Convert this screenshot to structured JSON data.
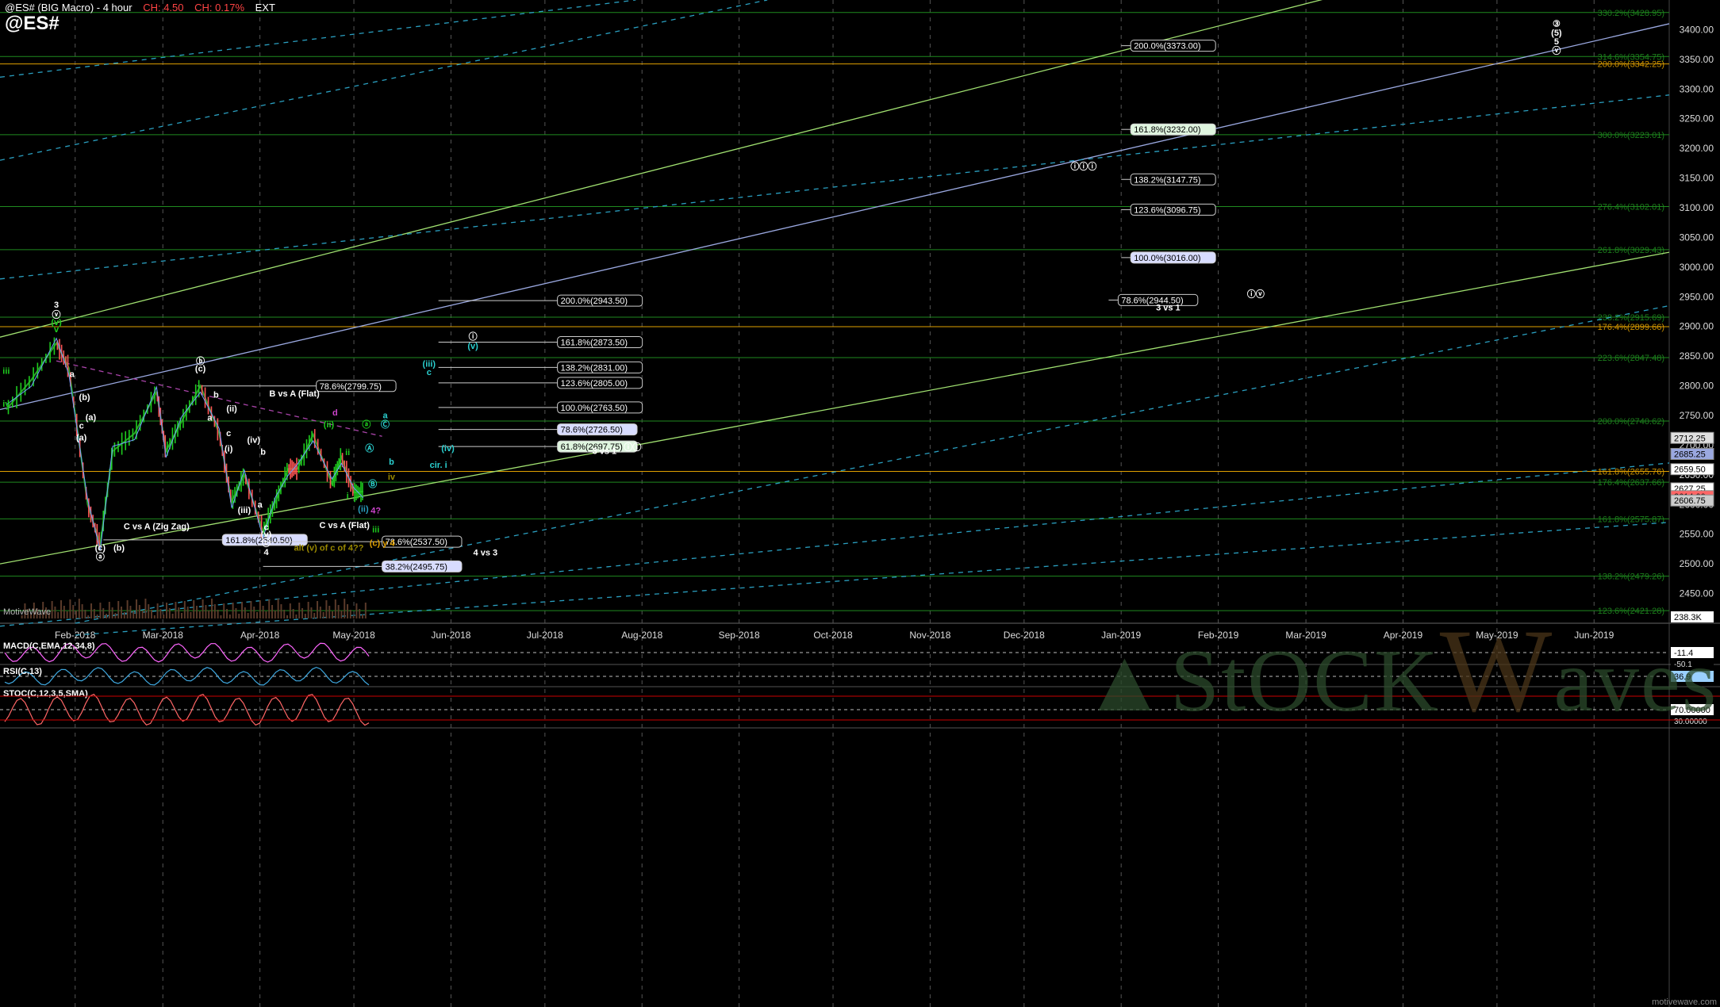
{
  "header": {
    "title": "@ES# (BIG Macro) - 4 hour",
    "change_abs": "CH: 4.50",
    "change_pct": "CH: 0.17%",
    "session": "EXT",
    "symbol": "@ES#"
  },
  "watermark": {
    "part1": "▲StOCK",
    "part2": "W",
    "part3": "aves"
  },
  "footer": "motivewave.com",
  "colors": {
    "bg": "#000000",
    "grid": "#555555",
    "fib_green": "#1f8a1f",
    "fib_orange": "#e0a000",
    "trend_green": "#a0e070",
    "trend_blue": "#9aa8e0",
    "channel_cyan": "#2a9fc0",
    "price_green": "#1ecc1e",
    "price_red": "#ff5555"
  },
  "chart_data": {
    "type": "line",
    "title": "@ES# (BIG Macro) - 4 hour",
    "x_ticks": [
      "Feb-2018",
      "Mar-2018",
      "Apr-2018",
      "May-2018",
      "Jun-2018",
      "Jul-2018",
      "Aug-2018",
      "Sep-2018",
      "Oct-2018",
      "Nov-2018",
      "Dec-2018",
      "Jan-2019",
      "Feb-2019",
      "Mar-2019",
      "Apr-2019",
      "May-2019",
      "Jun-2019"
    ],
    "y_ticks": [
      3400,
      3350,
      3300,
      3250,
      3200,
      3150,
      3100,
      3050,
      3000,
      2950,
      2900,
      2850,
      2800,
      2750,
      2700,
      2650,
      2600,
      2550,
      2500,
      2450
    ],
    "ylim": [
      2400,
      3450
    ],
    "price_path": [
      {
        "x": "2018-01-10",
        "y": 2760
      },
      {
        "x": "2018-01-18",
        "y": 2810
      },
      {
        "x": "2018-01-26",
        "y": 2872
      },
      {
        "x": "2018-01-30",
        "y": 2830
      },
      {
        "x": "2018-02-05",
        "y": 2600
      },
      {
        "x": "2018-02-09",
        "y": 2533
      },
      {
        "x": "2018-02-13",
        "y": 2690
      },
      {
        "x": "2018-02-20",
        "y": 2720
      },
      {
        "x": "2018-02-27",
        "y": 2790
      },
      {
        "x": "2018-03-02",
        "y": 2690
      },
      {
        "x": "2018-03-07",
        "y": 2740
      },
      {
        "x": "2018-03-13",
        "y": 2800
      },
      {
        "x": "2018-03-19",
        "y": 2720
      },
      {
        "x": "2018-03-23",
        "y": 2605
      },
      {
        "x": "2018-03-27",
        "y": 2650
      },
      {
        "x": "2018-04-02",
        "y": 2555
      },
      {
        "x": "2018-04-06",
        "y": 2605
      },
      {
        "x": "2018-04-10",
        "y": 2660
      },
      {
        "x": "2018-04-13",
        "y": 2660
      },
      {
        "x": "2018-04-18",
        "y": 2718
      },
      {
        "x": "2018-04-24",
        "y": 2635
      },
      {
        "x": "2018-04-27",
        "y": 2680
      },
      {
        "x": "2018-05-01",
        "y": 2620
      },
      {
        "x": "2018-05-04",
        "y": 2622
      }
    ],
    "last_price": "2627.25",
    "price_tags_right": [
      {
        "label": "2712.25",
        "y": 2712.25,
        "color": "#e0e0e0"
      },
      {
        "label": "2685.25",
        "y": 2685.25,
        "color": "#9aa8e0"
      },
      {
        "label": "2659.50",
        "y": 2659.5,
        "color": "#ffffff"
      },
      {
        "label": "2627.25",
        "y": 2627.25,
        "color": "#ffffff"
      },
      {
        "label": "2614.00",
        "y": 2614,
        "color": "#ff6666"
      },
      {
        "label": "2606.75",
        "y": 2606.75,
        "color": "#cccccc"
      }
    ],
    "fib_right": [
      {
        "label": "330.2%(3428.95)",
        "y": 3428.95,
        "color": "#1f8a1f"
      },
      {
        "label": "314.6%(3354.75)",
        "y": 3354.75,
        "color": "#1f8a1f"
      },
      {
        "label": "200.0%(3342.25)",
        "y": 3342.25,
        "color": "#e0a000"
      },
      {
        "label": "300.0%(3223.01)",
        "y": 3223.01,
        "color": "#1f8a1f"
      },
      {
        "label": "276.4%(3102.01)",
        "y": 3102.01,
        "color": "#1f8a1f"
      },
      {
        "label": "261.8%(3029.43)",
        "y": 3029.43,
        "color": "#1f8a1f"
      },
      {
        "label": "238.2%(2915.69)",
        "y": 2915.69,
        "color": "#1f8a1f"
      },
      {
        "label": "176.4%(2899.66)",
        "y": 2899.66,
        "color": "#e0a000"
      },
      {
        "label": "223.6%(2847.48)",
        "y": 2847.48,
        "color": "#1f8a1f"
      },
      {
        "label": "200.0%(2740.62)",
        "y": 2740.62,
        "color": "#1f8a1f"
      },
      {
        "label": "161.8%(2655.76)",
        "y": 2655.76,
        "color": "#e0a000"
      },
      {
        "label": "176.4%(2637.66)",
        "y": 2637.66,
        "color": "#1f8a1f"
      },
      {
        "label": "161.8%(2575.87)",
        "y": 2575.87,
        "color": "#1f8a1f"
      },
      {
        "label": "138.2%(2479.26)",
        "y": 2479.26,
        "color": "#1f8a1f"
      },
      {
        "label": "123.6%(2421.28)",
        "y": 2421.28,
        "color": "#1f8a1f"
      }
    ],
    "fib_boxes": [
      {
        "label": "200.0%(3373.00)",
        "y": 3373,
        "start": "2019-01-01",
        "fill": "#000000",
        "text": "#ffffff"
      },
      {
        "label": "161.8%(3232.00)",
        "y": 3232,
        "start": "2019-01-01",
        "fill": "#dff5df",
        "text": "#000000"
      },
      {
        "label": "138.2%(3147.75)",
        "y": 3147.75,
        "start": "2019-01-01",
        "fill": "#000000",
        "text": "#ffffff"
      },
      {
        "label": "123.6%(3096.75)",
        "y": 3096.75,
        "start": "2019-01-01",
        "fill": "#000000",
        "text": "#ffffff"
      },
      {
        "label": "100.0%(3016.00)",
        "y": 3016,
        "start": "2019-01-01",
        "fill": "#d8dcff",
        "text": "#000000"
      },
      {
        "label": "78.6%(2944.50)",
        "y": 2944.5,
        "start": "2018-12-28",
        "fill": "#000000",
        "text": "#ffffff"
      },
      {
        "label": "200.0%(2943.50)",
        "y": 2943.5,
        "start": "2018-05-28",
        "fill": "#000000",
        "text": "#ffffff"
      },
      {
        "label": "161.8%(2873.50)",
        "y": 2873.5,
        "start": "2018-05-28",
        "fill": "#000000",
        "text": "#ffffff"
      },
      {
        "label": "138.2%(2831.00)",
        "y": 2831,
        "start": "2018-05-28",
        "fill": "#000000",
        "text": "#ffffff"
      },
      {
        "label": "123.6%(2805.00)",
        "y": 2805,
        "start": "2018-05-28",
        "fill": "#000000",
        "text": "#ffffff"
      },
      {
        "label": "100.0%(2763.50)",
        "y": 2763.5,
        "start": "2018-05-28",
        "fill": "#000000",
        "text": "#ffffff"
      },
      {
        "label": "78.6%(2726.50)",
        "y": 2726.5,
        "start": "2018-05-28",
        "fill": "#d8dcff",
        "text": "#000000"
      },
      {
        "label": "61.8%(2697.75)",
        "y": 2697.75,
        "start": "2018-05-28",
        "fill": "#dff5df",
        "text": "#000000"
      },
      {
        "label": "78.6%(2799.75)",
        "y": 2799.75,
        "start": "2018-03-12",
        "fill": "#000000",
        "text": "#ffffff"
      },
      {
        "label": "161.8%(2540.50)",
        "y": 2540.5,
        "start": "2018-02-10",
        "fill": "#d8dcff",
        "text": "#000000"
      },
      {
        "label": "78.6%(2537.50)",
        "y": 2537.5,
        "start": "2018-04-02",
        "fill": "#000000",
        "text": "#ffffff"
      },
      {
        "label": "38.2%(2495.75)",
        "y": 2495.75,
        "start": "2018-04-02",
        "fill": "#d8dcff",
        "text": "#000000"
      }
    ],
    "annotations": [
      {
        "text": "3",
        "x": "2018-01-26",
        "y": 2932,
        "color": "#ffffff"
      },
      {
        "text": "ⓥ",
        "x": "2018-01-26",
        "y": 2915,
        "color": "#ffffff"
      },
      {
        "text": "(v)",
        "x": "2018-01-26",
        "y": 2902,
        "color": "#1ecc1e"
      },
      {
        "text": "v",
        "x": "2018-01-26",
        "y": 2890,
        "color": "#1ecc1e"
      },
      {
        "text": "iii",
        "x": "2018-01-10",
        "y": 2820,
        "color": "#1ecc1e"
      },
      {
        "text": "iv",
        "x": "2018-01-10",
        "y": 2765,
        "color": "#1ecc1e"
      },
      {
        "text": "a",
        "x": "2018-01-31",
        "y": 2815,
        "color": "#ffffff"
      },
      {
        "text": "(b)",
        "x": "2018-02-04",
        "y": 2776,
        "color": "#ffffff"
      },
      {
        "text": "(a)",
        "x": "2018-02-06",
        "y": 2742,
        "color": "#ffffff"
      },
      {
        "text": "c",
        "x": "2018-02-03",
        "y": 2728,
        "color": "#ffffff"
      },
      {
        "text": "(a)",
        "x": "2018-02-03",
        "y": 2708,
        "color": "#ffffff"
      },
      {
        "text": "C vs A (Zig Zag)",
        "x": "2018-02-27",
        "y": 2558,
        "color": "#ffffff"
      },
      {
        "text": "(c)",
        "x": "2018-02-09",
        "y": 2522,
        "color": "#ffffff"
      },
      {
        "text": "(b)",
        "x": "2018-02-15",
        "y": 2522,
        "color": "#ffffff"
      },
      {
        "text": "ⓐ",
        "x": "2018-02-09",
        "y": 2507,
        "color": "#ffffff"
      },
      {
        "text": "ⓑ",
        "x": "2018-03-13",
        "y": 2837,
        "color": "#ffffff"
      },
      {
        "text": "(c)",
        "x": "2018-03-13",
        "y": 2824,
        "color": "#ffffff"
      },
      {
        "text": "B vs A (Flat)",
        "x": "2018-04-12",
        "y": 2782,
        "color": "#ffffff"
      },
      {
        "text": "b",
        "x": "2018-03-18",
        "y": 2780,
        "color": "#ffffff"
      },
      {
        "text": "(ii)",
        "x": "2018-03-23",
        "y": 2757,
        "color": "#ffffff"
      },
      {
        "text": "a",
        "x": "2018-03-16",
        "y": 2741,
        "color": "#ffffff"
      },
      {
        "text": "c",
        "x": "2018-03-22",
        "y": 2715,
        "color": "#ffffff"
      },
      {
        "text": "(iv)",
        "x": "2018-03-30",
        "y": 2704,
        "color": "#ffffff"
      },
      {
        "text": "(i)",
        "x": "2018-03-22",
        "y": 2689,
        "color": "#ffffff"
      },
      {
        "text": "b",
        "x": "2018-04-02",
        "y": 2684,
        "color": "#ffffff"
      },
      {
        "text": "a",
        "x": "2018-04-01",
        "y": 2595,
        "color": "#ffffff"
      },
      {
        "text": "(iii)",
        "x": "2018-03-27",
        "y": 2586,
        "color": "#ffffff"
      },
      {
        "text": "c",
        "x": "2018-04-03",
        "y": 2557,
        "color": "#ffffff"
      },
      {
        "text": "(v)",
        "x": "2018-04-03",
        "y": 2545,
        "color": "#ffffff"
      },
      {
        "text": "ⓒ",
        "x": "2018-04-03",
        "y": 2530,
        "color": "#ffffff"
      },
      {
        "text": "4",
        "x": "2018-04-03",
        "y": 2515,
        "color": "#ffffff"
      },
      {
        "text": "C vs A (Flat)",
        "x": "2018-04-28",
        "y": 2560,
        "color": "#ffffff"
      },
      {
        "text": "alt (v) of c of 4??",
        "x": "2018-04-23",
        "y": 2522,
        "color": "#998800"
      },
      {
        "text": "(c) y 4",
        "x": "2018-05-10",
        "y": 2530,
        "color": "#e0a000"
      },
      {
        "text": "4 vs 3",
        "x": "2018-06-12",
        "y": 2514,
        "color": "#ffffff"
      },
      {
        "text": "d",
        "x": "2018-04-25",
        "y": 2750,
        "color": "#cc44cc"
      },
      {
        "text": "(ii)",
        "x": "2018-04-23",
        "y": 2730,
        "color": "#1ecc1e"
      },
      {
        "text": "ⓐ",
        "x": "2018-05-05",
        "y": 2730,
        "color": "#1ecc1e"
      },
      {
        "text": "ii",
        "x": "2018-04-29",
        "y": 2683,
        "color": "#1ecc1e"
      },
      {
        "text": "i",
        "x": "2018-04-29",
        "y": 2610,
        "color": "#1ecc1e"
      },
      {
        "text": "(ii)",
        "x": "2018-05-04",
        "y": 2588,
        "color": "#2a9fc0"
      },
      {
        "text": "4?",
        "x": "2018-05-08",
        "y": 2585,
        "color": "#cc44cc"
      },
      {
        "text": "iii",
        "x": "2018-05-08",
        "y": 2553,
        "color": "#1ecc1e"
      },
      {
        "text": "Ⓐ",
        "x": "2018-05-06",
        "y": 2690,
        "color": "#2ad0d0"
      },
      {
        "text": "Ⓑ",
        "x": "2018-05-07",
        "y": 2630,
        "color": "#2ad0d0"
      },
      {
        "text": "Ⓒ",
        "x": "2018-05-11",
        "y": 2730,
        "color": "#2ad0d0"
      },
      {
        "text": "a",
        "x": "2018-05-11",
        "y": 2745,
        "color": "#2ad0d0"
      },
      {
        "text": "b",
        "x": "2018-05-13",
        "y": 2667,
        "color": "#2ad0d0"
      },
      {
        "text": "iv",
        "x": "2018-05-13",
        "y": 2642,
        "color": "#998800"
      },
      {
        "text": "ⓘ",
        "x": "2018-06-08",
        "y": 2878,
        "color": "#ffffff"
      },
      {
        "text": "(v)",
        "x": "2018-06-08",
        "y": 2862,
        "color": "#2ad0d0"
      },
      {
        "text": "(iii)",
        "x": "2018-05-25",
        "y": 2832,
        "color": "#2ad0d0"
      },
      {
        "text": "c",
        "x": "2018-05-25",
        "y": 2818,
        "color": "#2ad0d0"
      },
      {
        "text": "(iv)",
        "x": "2018-05-31",
        "y": 2690,
        "color": "#2ad0d0"
      },
      {
        "text": "cir. i",
        "x": "2018-05-28",
        "y": 2662,
        "color": "#2ad0d0"
      },
      {
        "text": "3 vs 1",
        "x": "2018-07-20",
        "y": 2685,
        "color": "#ffffff"
      },
      {
        "text": "ⓘⓘ",
        "x": "2018-07-29",
        "y": 2692,
        "color": "#ffffff"
      },
      {
        "text": "ⓘⓘⓘ",
        "x": "2018-12-20",
        "y": 3165,
        "color": "#ffffff"
      },
      {
        "text": "3 vs 1",
        "x": "2019-01-16",
        "y": 2927,
        "color": "#ffffff"
      },
      {
        "text": "ⓘⓥ",
        "x": "2019-02-13",
        "y": 2950,
        "color": "#ffffff"
      },
      {
        "text": "③",
        "x": "2019-05-20",
        "y": 3405,
        "color": "#ffffff"
      },
      {
        "text": "(5)",
        "x": "2019-05-20",
        "y": 3390,
        "color": "#ffffff"
      },
      {
        "text": "5",
        "x": "2019-05-20",
        "y": 3375,
        "color": "#ffffff"
      },
      {
        "text": "ⓥ",
        "x": "2019-05-20",
        "y": 3360,
        "color": "#ffffff"
      }
    ],
    "indicators": [
      {
        "label": "MACD(C,EMA,12,34,8)",
        "value": "-11.4",
        "ref": "-50.1"
      },
      {
        "label": "RSI(C,13)",
        "value": "36.9",
        "ref": ""
      },
      {
        "label": "STOC(C,12,3,5,SMA)",
        "value": "70.00000",
        "ref": "30.00000"
      }
    ],
    "volume_label": "MotiveWave",
    "volume_value": "238.3K"
  }
}
